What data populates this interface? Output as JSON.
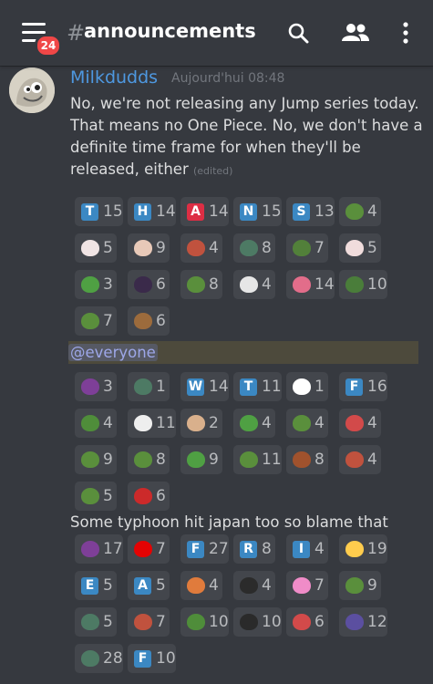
{
  "header": {
    "badge_count": "24",
    "hash": "#",
    "channel_name": "announcements"
  },
  "message": {
    "author": "Milkdudds",
    "timestamp": "Aujourd'hui 08:48",
    "text": "No, we're not releasing any Jump series today. That means no One Piece. No, we don't have a definite time frame for when they'll be released, either",
    "edited_label": "(edited)",
    "mention": "@everyone",
    "followup": "Some typhoon hit japan too so blame that"
  },
  "reaction_groups": [
    {
      "rows": [
        [
          {
            "icon": "letter-t",
            "label": "T",
            "color": "#3b88c3",
            "count": "15"
          },
          {
            "icon": "letter-h",
            "label": "H",
            "color": "#3b88c3",
            "count": "14"
          },
          {
            "icon": "letter-a",
            "label": "A",
            "color": "#dd2e44",
            "count": "14"
          },
          {
            "icon": "letter-n",
            "label": "N",
            "color": "#3b88c3",
            "count": "15"
          },
          {
            "icon": "letter-s",
            "label": "S",
            "color": "#3b88c3",
            "count": "13"
          },
          {
            "icon": "pepe-thumbs-icon",
            "color": "#5a8f3c",
            "count": "4"
          }
        ],
        [
          {
            "icon": "cat-emote-icon",
            "color": "#f0e4e4",
            "count": "5"
          },
          {
            "icon": "anime-face-icon",
            "color": "#e8c9b8",
            "count": "9"
          },
          {
            "icon": "meat-emote-icon",
            "color": "#c0523e",
            "count": "4"
          },
          {
            "icon": "pepe-sign-icon",
            "color": "#4d7a64",
            "count": "8"
          },
          {
            "icon": "pepe-gun-icon",
            "color": "#52803a",
            "count": "7"
          },
          {
            "icon": "cat-emote-icon",
            "color": "#f0dcdc",
            "count": "5"
          }
        ],
        [
          {
            "icon": "pepe-frog-icon",
            "color": "#4fa043",
            "count": "3"
          },
          {
            "icon": "dark-anime-icon",
            "color": "#3a2a4a",
            "count": "6"
          },
          {
            "icon": "pepe-point-icon",
            "color": "#5a8f3c",
            "count": "8"
          },
          {
            "icon": "cat-white-icon",
            "color": "#e6e6e6",
            "count": "4"
          },
          {
            "icon": "pink-anime-icon",
            "color": "#e26d8a",
            "count": "14"
          },
          {
            "icon": "pepe-reading-icon",
            "color": "#4a7d3a",
            "count": "10"
          }
        ],
        [
          {
            "icon": "pepe-think-icon",
            "color": "#5a8f3c",
            "count": "7"
          },
          {
            "icon": "bear-face-icon",
            "color": "#9c6b3c",
            "count": "6"
          }
        ]
      ]
    },
    {
      "rows": [
        [
          {
            "icon": "eggplant-icon",
            "color": "#7e3f98",
            "count": "3"
          },
          {
            "icon": "pepe-sign-icon",
            "color": "#4d7a64",
            "count": "1"
          },
          {
            "icon": "letter-w",
            "label": "W",
            "color": "#3b88c3",
            "count": "14"
          },
          {
            "icon": "letter-t",
            "label": "T",
            "color": "#3b88c3",
            "count": "11"
          },
          {
            "icon": "panda-icon",
            "color": "#ffffff",
            "count": "1"
          },
          {
            "icon": "letter-f",
            "label": "F",
            "color": "#3b88c3",
            "count": "16"
          }
        ],
        [
          {
            "icon": "pepe-laugh-icon",
            "color": "#4f8d3a",
            "count": "4"
          },
          {
            "icon": "sketch-face-icon",
            "color": "#eeeeee",
            "count": "11"
          },
          {
            "icon": "anime-girl-icon",
            "color": "#d9b08c",
            "count": "2"
          },
          {
            "icon": "pepe-ball-icon",
            "color": "#4fa043",
            "count": "4"
          },
          {
            "icon": "pepe-frog-icon",
            "color": "#5a8f3c",
            "count": "4"
          },
          {
            "icon": "anime-red-icon",
            "color": "#d24a4a",
            "count": "4"
          }
        ],
        [
          {
            "icon": "pepe-think-icon",
            "color": "#5a8f3c",
            "count": "9"
          },
          {
            "icon": "pepe-think-icon",
            "color": "#5a8f3c",
            "count": "8"
          },
          {
            "icon": "pepe-smug-icon",
            "color": "#4fa043",
            "count": "9"
          },
          {
            "icon": "pepe-blush-icon",
            "color": "#5a8f3c",
            "count": "11"
          },
          {
            "icon": "pepe-wall-icon",
            "color": "#a0522d",
            "count": "8"
          },
          {
            "icon": "meat-emote-icon",
            "color": "#c0523e",
            "count": "4"
          }
        ],
        [
          {
            "icon": "pepe-gun-icon",
            "color": "#5a8f3c",
            "count": "5"
          },
          {
            "icon": "red-blur-icon",
            "color": "#cc2a2a",
            "count": "6"
          }
        ]
      ]
    },
    {
      "rows": [
        [
          {
            "icon": "eggplant-icon",
            "color": "#7e3f98",
            "count": "17"
          },
          {
            "icon": "rainbow-flag-icon",
            "color": "#e40303",
            "count": "7"
          },
          {
            "icon": "letter-f",
            "label": "F",
            "color": "#3b88c3",
            "count": "27"
          },
          {
            "icon": "letter-r",
            "label": "R",
            "color": "#3b88c3",
            "count": "8"
          },
          {
            "icon": "letter-i",
            "label": "I",
            "color": "#3b88c3",
            "count": "4"
          },
          {
            "icon": "crying-face-icon",
            "color": "#ffcc4d",
            "count": "19"
          }
        ],
        [
          {
            "icon": "letter-e",
            "label": "E",
            "color": "#3b88c3",
            "count": "5"
          },
          {
            "icon": "letter-a",
            "label": "A",
            "color": "#3b88c3",
            "count": "5"
          },
          {
            "icon": "hand-emote-icon",
            "color": "#e07b3c",
            "count": "4"
          },
          {
            "icon": "whip-icon",
            "color": "#2b2b2b",
            "count": "4"
          },
          {
            "icon": "pink-creature-icon",
            "color": "#f08cc8",
            "count": "7"
          },
          {
            "icon": "pepe-heart-icon",
            "color": "#5a8f3c",
            "count": "9"
          }
        ],
        [
          {
            "icon": "pepe-sign-icon",
            "color": "#4d7a64",
            "count": "5"
          },
          {
            "icon": "meat-emote-icon",
            "color": "#c0523e",
            "count": "7"
          },
          {
            "icon": "pepe-laugh-icon",
            "color": "#4f8d3a",
            "count": "10"
          },
          {
            "icon": "dark-face-icon",
            "color": "#2a2a2a",
            "count": "10"
          },
          {
            "icon": "anime-red-icon",
            "color": "#d24a4a",
            "count": "6"
          },
          {
            "icon": "pepe-wizard-icon",
            "color": "#5b4fa0",
            "count": "12"
          }
        ],
        [
          {
            "icon": "pepe-sign-icon",
            "color": "#4d7a64",
            "count": "28"
          },
          {
            "icon": "letter-f-pepe-icon",
            "label": "F",
            "color": "#3b88c3",
            "count": "10"
          }
        ]
      ]
    }
  ]
}
